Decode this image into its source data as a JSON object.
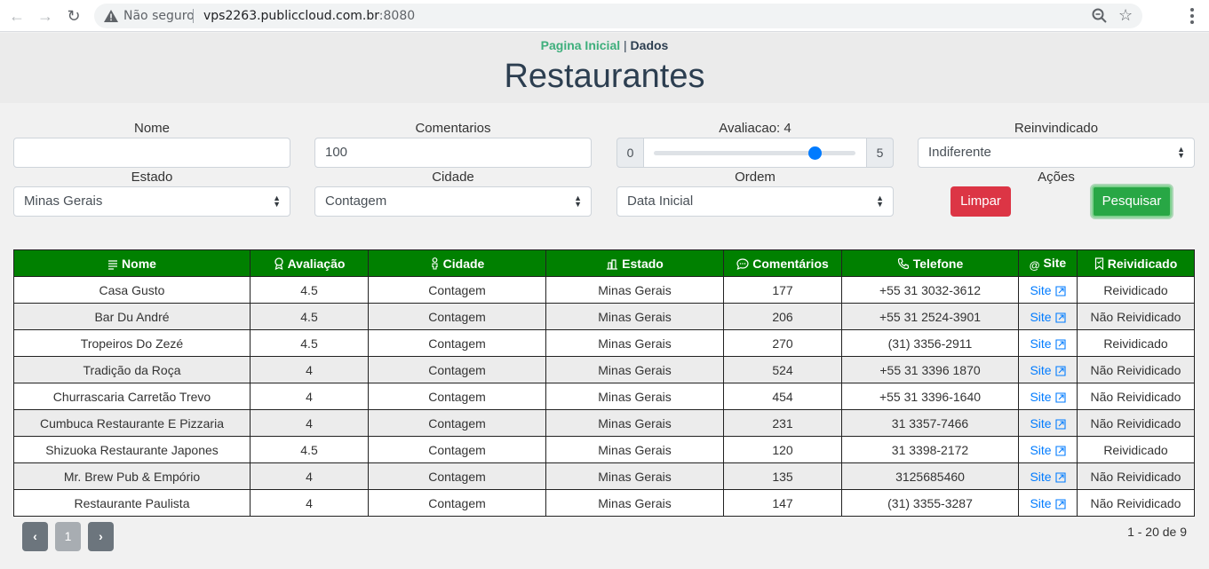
{
  "browser": {
    "security_label": "Não seguro",
    "url_host": "vps2263.publiccloud.com.br",
    "url_port": ":8080",
    "nav": {
      "back": "←",
      "forward": "→",
      "reload": "↻"
    }
  },
  "header": {
    "crumb_home": "Pagina Inicial",
    "crumb_sep": " | ",
    "crumb_current": "Dados",
    "title": "Restaurantes"
  },
  "filters": {
    "nome_label": "Nome",
    "nome_value": "",
    "comentarios_label": "Comentarios",
    "comentarios_value": "100",
    "avaliacao_label": "Avaliacao: 4",
    "avaliacao_min": "0",
    "avaliacao_max": "5",
    "avaliacao_value": 4,
    "reinvindicado_label": "Reinvindicado",
    "reinvindicado_value": "Indiferente",
    "estado_label": "Estado",
    "estado_value": "Minas Gerais",
    "cidade_label": "Cidade",
    "cidade_value": "Contagem",
    "ordem_label": "Ordem",
    "ordem_value": "Data Inicial",
    "acoes_label": "Ações",
    "limpar": "Limpar",
    "pesquisar": "Pesquisar"
  },
  "table": {
    "headers": [
      "Nome",
      "Avaliação",
      "Cidade",
      "Estado",
      "Comentários",
      "Telefone",
      "Site",
      "Reividicado"
    ],
    "header_icons": [
      "list-icon",
      "award-icon",
      "person-icon",
      "building-icon",
      "chat-icon",
      "phone-icon",
      "at-icon",
      "bookmark-icon"
    ],
    "site_label": "Site",
    "rows": [
      [
        "Casa Gusto",
        "4.5",
        "Contagem",
        "Minas Gerais",
        "177",
        "+55 31 3032-3612",
        "Site",
        "Reividicado"
      ],
      [
        "Bar Du André",
        "4.5",
        "Contagem",
        "Minas Gerais",
        "206",
        "+55 31 2524-3901",
        "Site",
        "Não Reividicado"
      ],
      [
        "Tropeiros Do Zezé",
        "4.5",
        "Contagem",
        "Minas Gerais",
        "270",
        "(31) 3356-2911",
        "Site",
        "Reividicado"
      ],
      [
        "Tradição da Roça",
        "4",
        "Contagem",
        "Minas Gerais",
        "524",
        "+55 31 3396 1870",
        "Site",
        "Não Reividicado"
      ],
      [
        "Churrascaria Carretão Trevo",
        "4",
        "Contagem",
        "Minas Gerais",
        "454",
        "+55 31 3396-1640",
        "Site",
        "Não Reividicado"
      ],
      [
        "Cumbuca Restaurante E Pizzaria",
        "4",
        "Contagem",
        "Minas Gerais",
        "231",
        "31 3357-7466",
        "Site",
        "Não Reividicado"
      ],
      [
        "Shizuoka Restaurante Japones",
        "4.5",
        "Contagem",
        "Minas Gerais",
        "120",
        "31 3398-2172",
        "Site",
        "Reividicado"
      ],
      [
        "Mr. Brew Pub & Empório",
        "4",
        "Contagem",
        "Minas Gerais",
        "135",
        "3125685460",
        "Site",
        "Não Reividicado"
      ],
      [
        "Restaurante Paulista",
        "4",
        "Contagem",
        "Minas Gerais",
        "147",
        "(31) 3355-3287",
        "Site",
        "Não Reividicado"
      ]
    ]
  },
  "pagination": {
    "prev": "‹",
    "page": "1",
    "next": "›",
    "range_text": "1 - 20 de 9"
  },
  "colors": {
    "table_header": "#008000",
    "breadcrumb_link": "#3eaf7c",
    "title": "#2c3e50",
    "clear_button": "#dc3545",
    "search_button": "#28a745",
    "slider_thumb": "#007bff",
    "link": "#007bff"
  }
}
